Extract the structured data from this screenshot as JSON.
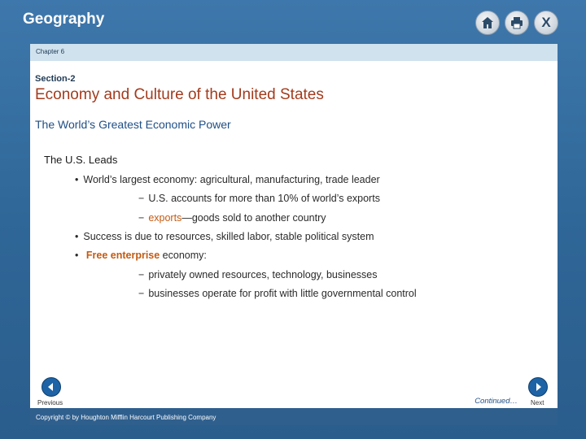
{
  "app": {
    "title": "Geography"
  },
  "toolbar": {
    "home_icon": "home-icon",
    "print_icon": "print-icon",
    "close_icon": "close-icon",
    "close_glyph": "X"
  },
  "chapter": {
    "label": "Chapter 6"
  },
  "section": {
    "label": "Section-2",
    "title": "Economy and Culture of the United States",
    "subtitle": "The World’s Greatest Economic Power"
  },
  "content": {
    "heading": "The U.S. Leads",
    "bullet_glyph": "•",
    "dash_glyph": "−",
    "bullet1": "World’s largest economy: agricultural, manufacturing, trade leader",
    "sub1": "U.S. accounts for more than 10% of world’s exports",
    "sub2_term": "exports",
    "sub2_rest": "—goods sold to another country",
    "bullet2": "Success is due to resources, skilled labor, stable political system",
    "bullet3_term": "Free enterprise",
    "bullet3_rest": " economy:",
    "sub3": "privately owned resources, technology, businesses",
    "sub4": "businesses operate for profit with little governmental control"
  },
  "nav": {
    "previous_label": "Previous",
    "next_label": "Next",
    "continued": "Continued…"
  },
  "footer": {
    "copyright": "Copyright © by Houghton Mifflin Harcourt Publishing Company"
  },
  "colors": {
    "frame": "#2f6798",
    "title_red": "#a23b1d",
    "subtitle_blue": "#1f4f86",
    "highlight_orange": "#c45a11",
    "chapter_bar": "#cfe2ee",
    "nav_blue": "#1d63a6"
  }
}
